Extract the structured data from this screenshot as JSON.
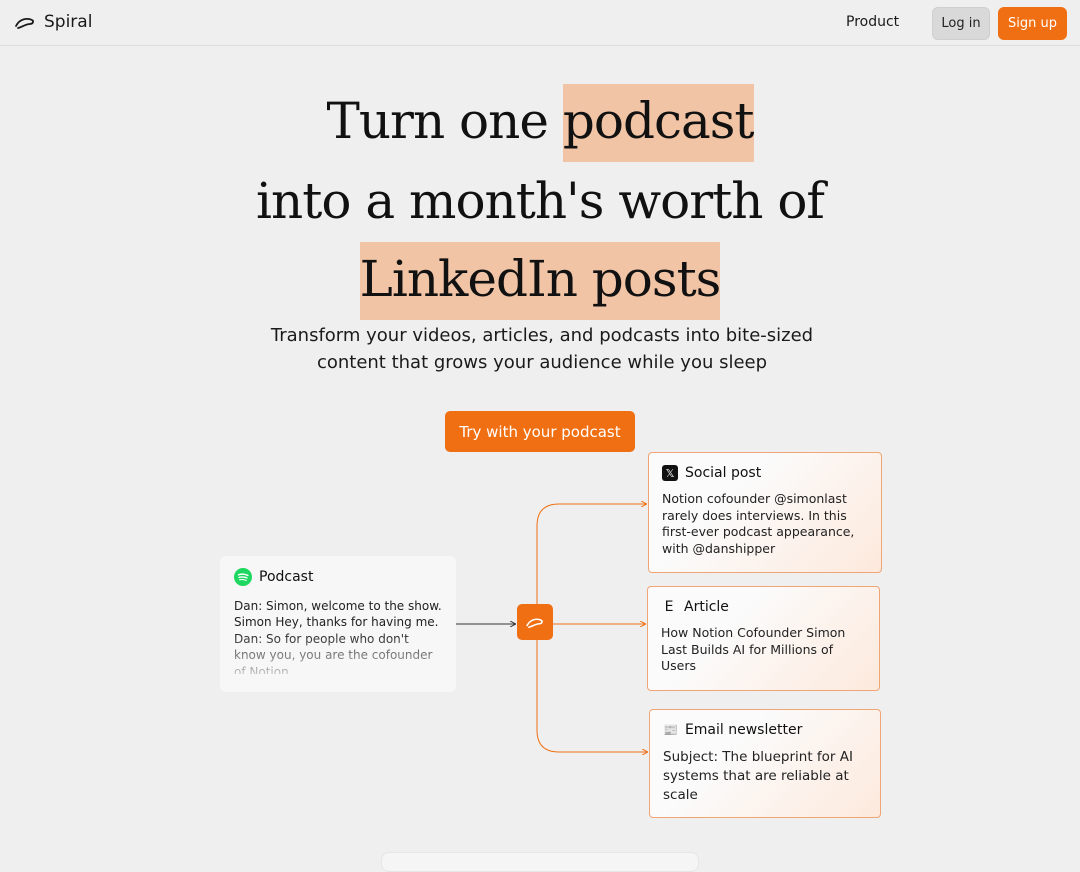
{
  "nav": {
    "brand": "Spiral",
    "product_link": "Product",
    "login_label": "Log in",
    "signup_label": "Sign up"
  },
  "hero": {
    "line1_pre": "Turn one ",
    "line1_highlight": "podcast",
    "line2": "into a month's worth of",
    "line3_highlight": "LinkedIn posts",
    "subtitle": "Transform your videos, articles, and podcasts into bite-sized content that grows your audience while you sleep",
    "cta_label": "Try with your podcast"
  },
  "diagram": {
    "podcast": {
      "title": "Podcast",
      "icon": "spotify-icon",
      "transcript": "Dan: Simon, welcome to the show. Simon  Hey, thanks for having me. Dan: So for people who don't know you, you are the cofounder of Notion."
    },
    "hub_icon": "spiral-logo-icon",
    "outputs": {
      "social": {
        "title": "Social post",
        "icon": "x-logo-icon",
        "body": "Notion cofounder @simonlast rarely does interviews.  In this first-ever podcast appearance, with @danshipper"
      },
      "article": {
        "title": "Article",
        "icon": "letter-e-icon",
        "icon_glyph": "E",
        "body": "How Notion Cofounder Simon Last Builds AI for Millions of Users"
      },
      "email": {
        "title": "Email newsletter",
        "icon": "newspaper-icon",
        "icon_glyph": "📰",
        "body": "Subject: The blueprint for AI systems that are reliable at scale"
      }
    }
  },
  "colors": {
    "accent": "#f06f12",
    "highlight": "#f1c4a6",
    "background": "#efefef",
    "card_border": "#f0a574"
  }
}
